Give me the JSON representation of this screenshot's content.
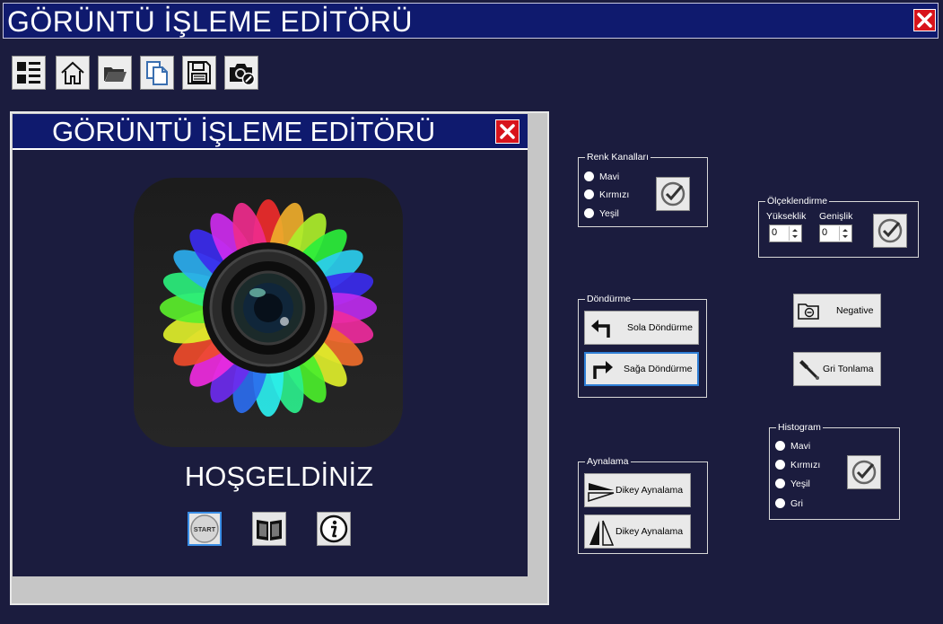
{
  "window": {
    "title": "GÖRÜNTÜ İŞLEME EDİTÖRÜ"
  },
  "toolbar": {
    "icons": [
      "menu-icon",
      "home-icon",
      "folder-open-icon",
      "copy-icon",
      "save-icon",
      "camera-edit-icon"
    ]
  },
  "welcome_panel": {
    "title": "GÖRÜNTÜ İŞLEME EDİTÖRÜ",
    "heading": "HOŞGELDİNİZ",
    "start_label": "START"
  },
  "renk_kanallari": {
    "label": "Renk Kanalları",
    "options": [
      "Mavi",
      "Kırmızı",
      "Yeşil"
    ]
  },
  "olceklendirme": {
    "label": "Ölçeklendirme",
    "height_label": "Yükseklik",
    "width_label": "Genişlik",
    "height_value": "0",
    "width_value": "0"
  },
  "dondurme": {
    "label": "Döndürme",
    "left_label": "Sola Döndürme",
    "right_label": "Sağa Döndürme"
  },
  "negative_label": "Negative",
  "gray_label": "Gri Tonlama",
  "aynalama": {
    "label": "Aynalama",
    "button1_label": "Dikey Aynalama",
    "button2_label": "Dikey Aynalama"
  },
  "histogram": {
    "label": "Histogram",
    "options": [
      "Mavi",
      "Kırmızı",
      "Yeşil",
      "Gri"
    ]
  },
  "colors": {
    "titlebar": "#0f1a6e",
    "background": "#1b1c3e",
    "close": "#d8141c"
  }
}
